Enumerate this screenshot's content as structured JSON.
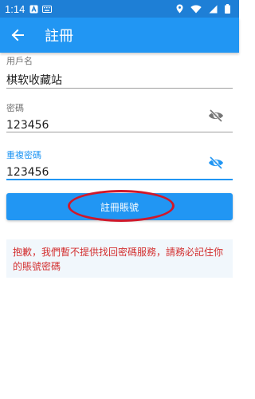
{
  "status_bar": {
    "time": "1:14",
    "icons_left": [
      "a-badge-icon",
      "keyboard-icon"
    ],
    "icons_right": [
      "location-icon",
      "wifi-icon",
      "signal-icon",
      "battery-icon"
    ]
  },
  "app_bar": {
    "title": "註冊",
    "back_icon": "arrow-back-icon",
    "background": "#2196f3"
  },
  "form": {
    "username": {
      "label": "用戶名",
      "value": "棋软收藏站"
    },
    "password": {
      "label": "密碼",
      "value": "123456",
      "icon": "eye-off-icon"
    },
    "confirm_password": {
      "label": "重複密碼",
      "value": "123456",
      "icon": "eye-icon",
      "focused": true
    },
    "submit_label": "註冊賬號"
  },
  "annotation": {
    "color": "#d0182a",
    "shape": "ellipse around submit button"
  },
  "notice": {
    "text": "抱歉，我們暫不提供找回密碼服務，請務必記住你的賬號密碼",
    "color": "#d32f2f"
  }
}
